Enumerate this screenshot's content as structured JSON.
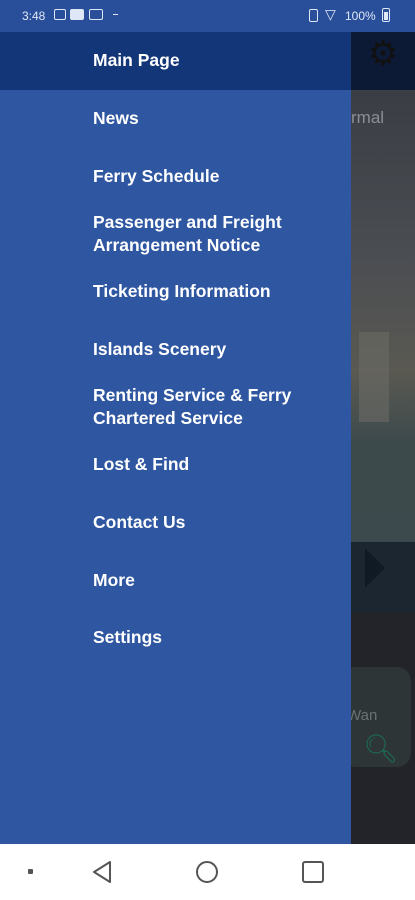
{
  "status_bar": {
    "time": "3:48",
    "battery": "100%"
  },
  "background": {
    "status_word": "rmal",
    "card_label": "Wan"
  },
  "drawer": {
    "header_item": "Main Page",
    "items": [
      {
        "label": "News"
      },
      {
        "label": "Ferry Schedule"
      },
      {
        "label": "Passenger and Freight Arrangement Notice"
      },
      {
        "label": "Ticketing Information"
      },
      {
        "label": "Islands Scenery"
      },
      {
        "label": "Renting Service & Ferry Chartered Service"
      },
      {
        "label": "Lost & Find"
      },
      {
        "label": "Contact Us"
      },
      {
        "label": "More"
      },
      {
        "label": "Settings"
      }
    ]
  },
  "colors": {
    "drawer_bg": "#2f56a0",
    "drawer_header_bg": "#133679",
    "status_bar_bg": "#2a4f9a"
  },
  "icons": [
    "gear-icon",
    "search-icon",
    "back-icon",
    "home-icon",
    "recents-icon",
    "wifi-icon",
    "battery-icon"
  ]
}
